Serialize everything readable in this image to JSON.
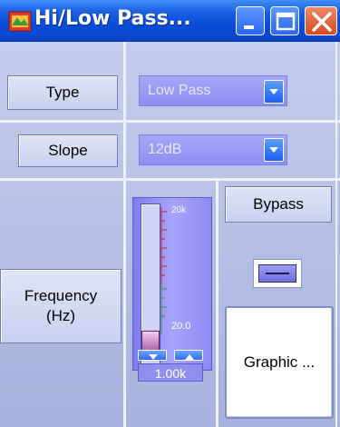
{
  "window": {
    "title": "Hi/Low Pass...",
    "controls": {
      "minimize": "minimize",
      "maximize": "maximize",
      "close": "close"
    }
  },
  "type": {
    "label": "Type",
    "value": "Low Pass"
  },
  "slope": {
    "label": "Slope",
    "value": "12dB"
  },
  "frequency": {
    "label": "Frequency\n(Hz)",
    "slider_max_label": "20k",
    "slider_min_label": "20.0",
    "value": "1.00k",
    "slider_position": 0.07
  },
  "bypass": {
    "label": "Bypass"
  },
  "graphic": {
    "label": "Graphic ..."
  }
}
